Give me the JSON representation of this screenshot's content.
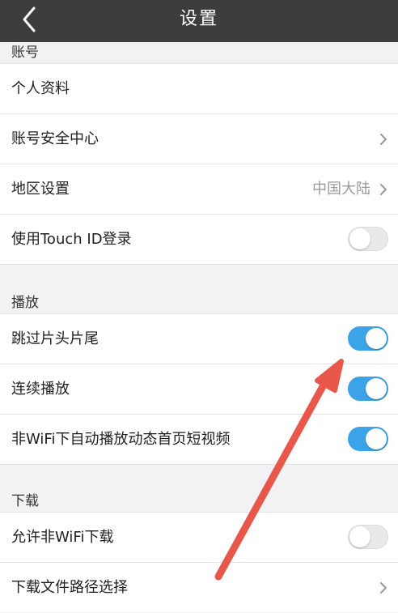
{
  "header": {
    "title": "设置",
    "back_icon": "chevron-left-icon"
  },
  "sections": {
    "account": {
      "title": "账号"
    },
    "playback": {
      "title": "播放"
    },
    "download": {
      "title": "下载"
    }
  },
  "rows": {
    "profile": {
      "label": "个人资料"
    },
    "security": {
      "label": "账号安全中心"
    },
    "region": {
      "label": "地区设置",
      "value": "中国大陆"
    },
    "touch_id": {
      "label": "使用Touch ID登录",
      "enabled": false
    },
    "skip_intro": {
      "label": "跳过片头片尾",
      "enabled": true
    },
    "autoplay_next": {
      "label": "连续播放",
      "enabled": true
    },
    "autoplay_non_wifi": {
      "label": "非WiFi下自动播放动态首页短视频",
      "enabled": true
    },
    "allow_non_wifi_download": {
      "label": "允许非WiFi下载",
      "enabled": false
    },
    "download_path": {
      "label": "下载文件路径选择"
    }
  },
  "colors": {
    "navbar": "#3d3d3f",
    "toggle_on": "#3ba4e8",
    "annotation_arrow": "#e8574a"
  }
}
